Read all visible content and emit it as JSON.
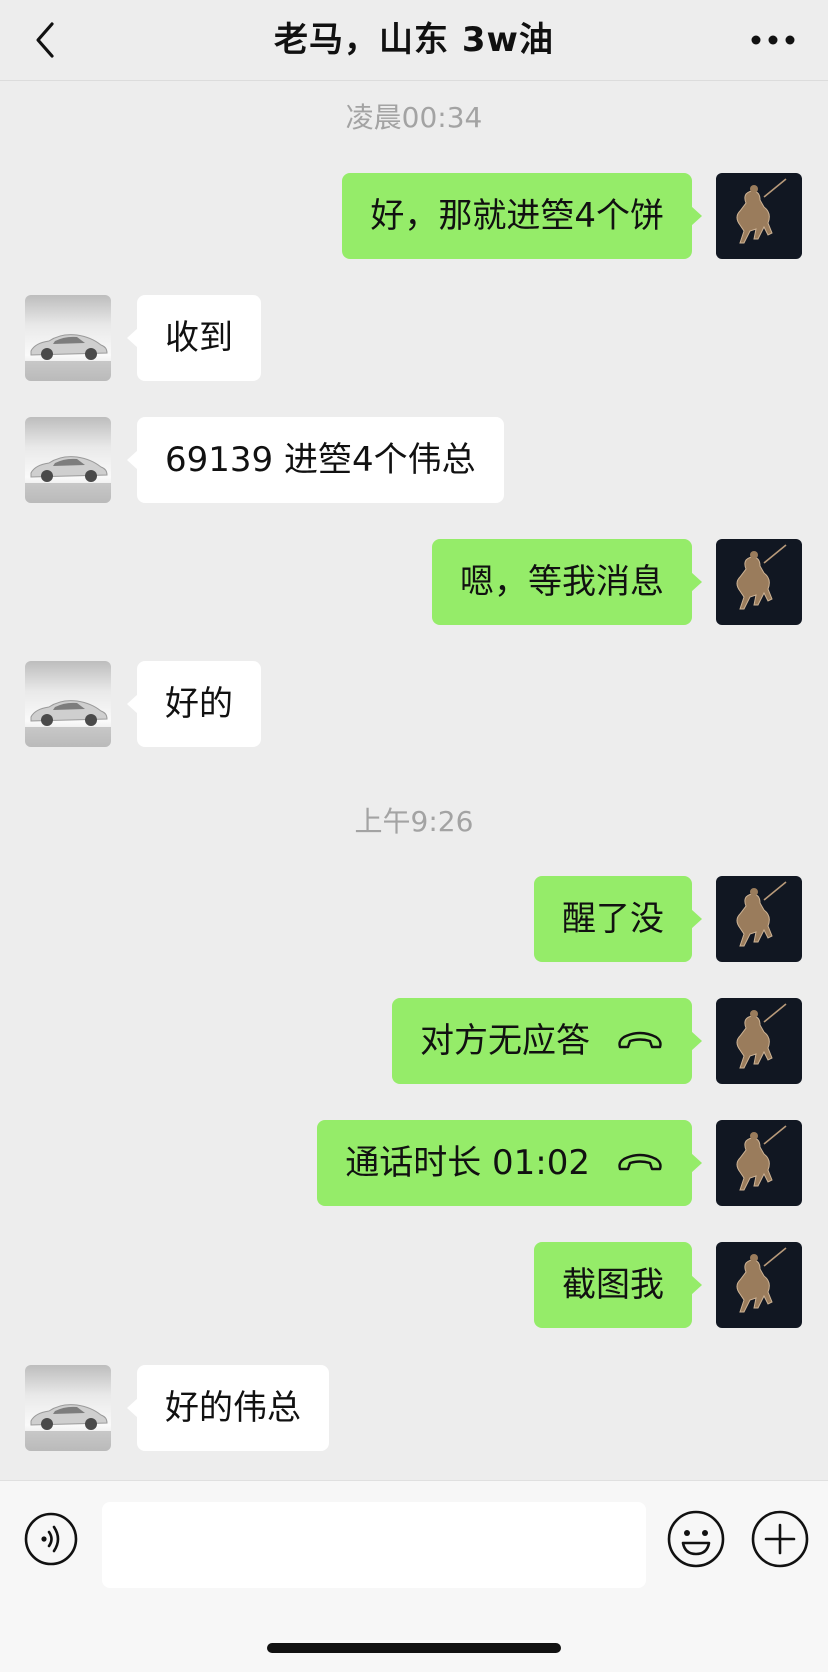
{
  "header": {
    "title": "老马，山东 3w油",
    "back_icon": "chevron-left-icon",
    "more_icon": "more-dots-icon"
  },
  "timestamps": [
    "凌晨00:34",
    "上午9:26"
  ],
  "messages": [
    {
      "from": "me",
      "text": "好，那就进箜4个饼"
    },
    {
      "from": "them",
      "text": "收到"
    },
    {
      "from": "them",
      "text": "69139 进箜4个伟总"
    },
    {
      "from": "me",
      "text": "嗯，等我消息"
    },
    {
      "from": "them",
      "text": "好的"
    },
    {
      "from": "me",
      "text": "醒了没"
    },
    {
      "from": "me",
      "text": "对方无应答",
      "icon": "phone-hangup-icon"
    },
    {
      "from": "me",
      "text": "通话时长 01:02",
      "icon": "phone-hangup-icon"
    },
    {
      "from": "me",
      "text": "截图我"
    },
    {
      "from": "them",
      "text": "好的伟总"
    }
  ],
  "input_bar": {
    "voice_icon": "voice-icon",
    "emoji_icon": "emoji-icon",
    "plus_icon": "plus-icon",
    "input_value": ""
  },
  "colors": {
    "background": "#ededed",
    "my_bubble": "#95ec69",
    "their_bubble": "#ffffff"
  }
}
